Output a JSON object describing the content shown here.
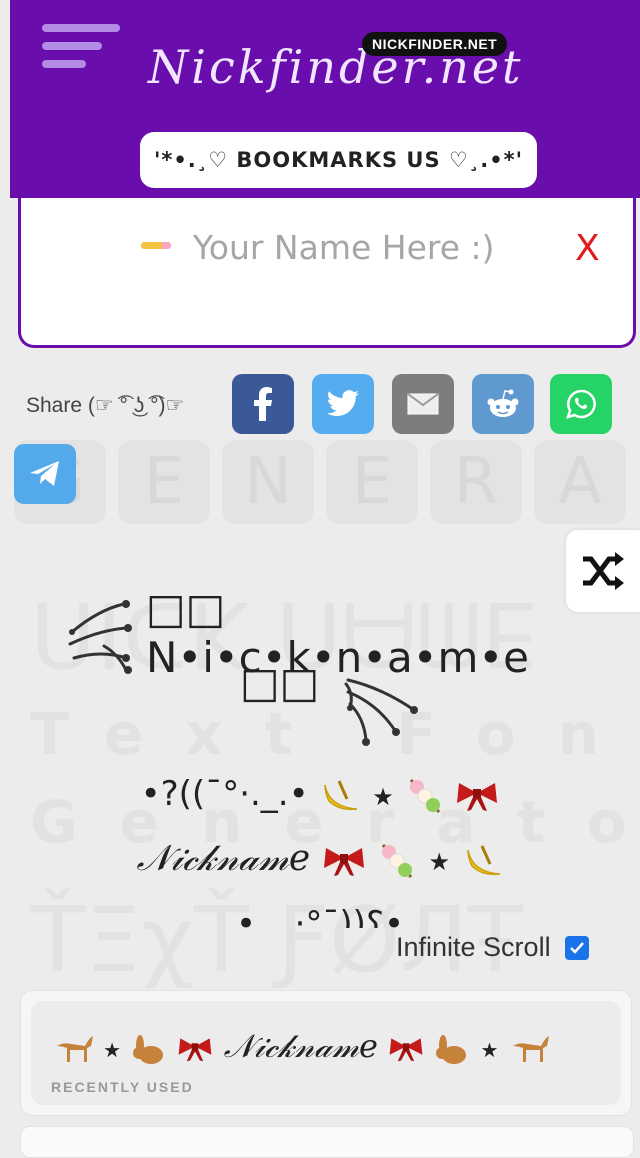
{
  "header": {
    "logo": "Nickfinder.net",
    "logo_tag": "NICKFINDER.NET",
    "bookmark": "'*•.¸♡ BOOKMARKS US ♡¸.•*'"
  },
  "name_input": {
    "placeholder": "Your Name Here :)",
    "value": "",
    "clear_label": "X"
  },
  "share": {
    "label": "Share (☞ ͡° ͜ʖ ͡°)☞",
    "buttons": [
      {
        "name": "facebook",
        "color": "#3b5998"
      },
      {
        "name": "twitter",
        "color": "#55acee"
      },
      {
        "name": "email",
        "color": "#7d7d7d"
      },
      {
        "name": "reddit",
        "color": "#5f99cf"
      },
      {
        "name": "whatsapp",
        "color": "#25d366"
      },
      {
        "name": "telegram",
        "color": "#54a9eb"
      }
    ]
  },
  "watermark": {
    "tiles": [
      "G",
      "E",
      "N",
      "E",
      "R",
      "A"
    ],
    "line1": "ᑎIᑕK ᑎᗩᗰE",
    "line2": "Text Font",
    "line3": "Generator",
    "line4": "ŤΞχŤ ƑØЛŦ"
  },
  "results": {
    "line1_text": "□□ N•i•c•k•n•a•m•e",
    "line2_text": "□□",
    "line3_text": "•?((¯°·._.•",
    "line4_text": "𝒩𝒾𝒸𝓀𝓃𝒶𝓂𝑒",
    "line5_text": "•._.·°¯))؟•",
    "star": "★"
  },
  "infinite_scroll": {
    "label": "Infinite Scroll",
    "checked": true
  },
  "recent": {
    "nickname": "𝒩𝒾𝒸𝓀𝓃𝒶𝓂𝑒",
    "label": "RECENTLY USED",
    "star": "★"
  },
  "colors": {
    "header_bg": "#6a0dad",
    "clear_x": "#e01b1b",
    "checkbox": "#1a73e8"
  }
}
